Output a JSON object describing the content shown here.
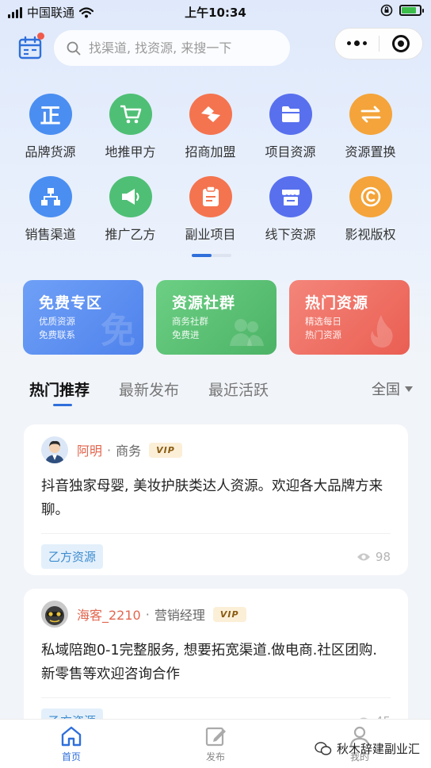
{
  "status_bar": {
    "carrier": "中国联通",
    "time": "上午10:34"
  },
  "search": {
    "placeholder": "找渠道, 找资源, 来搜一下"
  },
  "categories": [
    {
      "label": "品牌货源",
      "icon": "zheng-badge-icon",
      "color": "#4a8ef1"
    },
    {
      "label": "地推甲方",
      "icon": "shopping-cart-icon",
      "color": "#4fbf75"
    },
    {
      "label": "招商加盟",
      "icon": "handshake-icon",
      "color": "#f4744f"
    },
    {
      "label": "项目资源",
      "icon": "folder-icon",
      "color": "#5870ee"
    },
    {
      "label": "资源置换",
      "icon": "exchange-icon",
      "color": "#f4a43a"
    },
    {
      "label": "销售渠道",
      "icon": "org-chart-icon",
      "color": "#4a8ef1"
    },
    {
      "label": "推广乙方",
      "icon": "megaphone-icon",
      "color": "#4fbf75"
    },
    {
      "label": "副业项目",
      "icon": "clipboard-icon",
      "color": "#f4744f"
    },
    {
      "label": "线下资源",
      "icon": "store-icon",
      "color": "#5870ee"
    },
    {
      "label": "影视版权",
      "icon": "copyright-icon",
      "color": "#f4a43a"
    }
  ],
  "promos": [
    {
      "title": "免费专区",
      "line1": "优质资源",
      "line2": "免费联系",
      "watermark": "免"
    },
    {
      "title": "资源社群",
      "line1": "商务社群",
      "line2": "免费进",
      "watermark": ""
    },
    {
      "title": "热门资源",
      "line1": "精选每日",
      "line2": "热门资源",
      "watermark": ""
    }
  ],
  "tabs": {
    "items": [
      "热门推荐",
      "最新发布",
      "最近活跃"
    ],
    "active_index": 0,
    "region": "全国"
  },
  "posts": [
    {
      "name": "阿明",
      "role": "商务",
      "badge": "VIP",
      "content": "抖音独家母婴, 美妆护肤类达人资源。欢迎各大品牌方来聊。",
      "tag": "乙方资源",
      "views": "98"
    },
    {
      "name": "海客_2210",
      "role": "营销经理",
      "badge": "VIP",
      "content": "私域陪跑0-1完整服务, 想要拓宽渠道.做电商.社区团购.新零售等欢迎咨询合作",
      "tag": "乙方资源",
      "views": "45"
    }
  ],
  "bottom_nav": [
    {
      "label": "首页",
      "icon": "home-icon",
      "active": true
    },
    {
      "label": "发布",
      "icon": "edit-icon",
      "active": false
    },
    {
      "label": "我的",
      "icon": "user-icon",
      "active": false
    }
  ],
  "watermark": {
    "text": "秋木辞建副业汇"
  },
  "colors": {
    "accent": "#2f6fdb",
    "username": "#e2664f"
  }
}
